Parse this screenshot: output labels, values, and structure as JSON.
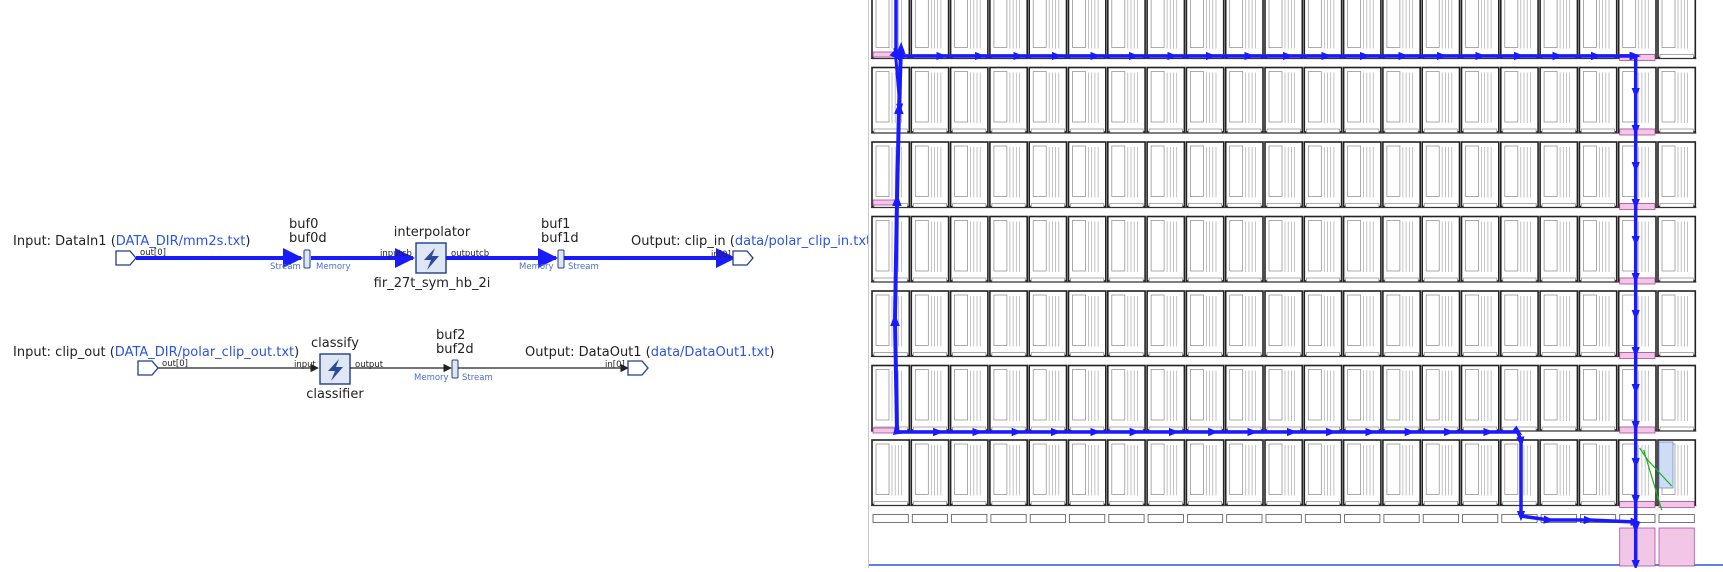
{
  "graph": {
    "net1": {
      "input_prefix": "Input: DataIn1 (",
      "input_file": "DATA_DIR/mm2s.txt",
      "input_suffix": ")",
      "input_port": "out[0]",
      "buf0_name": "buf0",
      "buf0d_name": "buf0d",
      "buf0_left_type": "Stream",
      "buf0_right_type": "Memory",
      "kernel_name": "interpolator",
      "kernel_func": "fir_27t_sym_hb_2i",
      "kernel_in_port": "inputcb",
      "kernel_out_port": "outputcb",
      "buf1_name": "buf1",
      "buf1d_name": "buf1d",
      "buf1_left_type": "Memory",
      "buf1_right_type": "Stream",
      "output_prefix": "Output: clip_in (",
      "output_file": "data/polar_clip_in.txt",
      "output_suffix": ")",
      "output_port": "in[0]"
    },
    "net2": {
      "input_prefix": "Input: clip_out (",
      "input_file": "DATA_DIR/polar_clip_out.txt",
      "input_suffix": ")",
      "input_port": "out[0]",
      "kernel_name": "classify",
      "kernel_func": "classifier",
      "kernel_in_port": "input",
      "kernel_out_port": "output",
      "buf2_name": "buf2",
      "buf2d_name": "buf2d",
      "buf2_left_type": "Memory",
      "buf2_right_type": "Stream",
      "output_prefix": "Output: DataOut1 (",
      "output_file": "data/DataOut1.txt",
      "output_suffix": ")",
      "output_port": "in[0]"
    }
  },
  "array_view": {
    "columns": 21,
    "rows": 7,
    "route_color": "#1a1aff",
    "highlight_color": "#f2c6e6",
    "aux_route_color": "#19b419"
  }
}
